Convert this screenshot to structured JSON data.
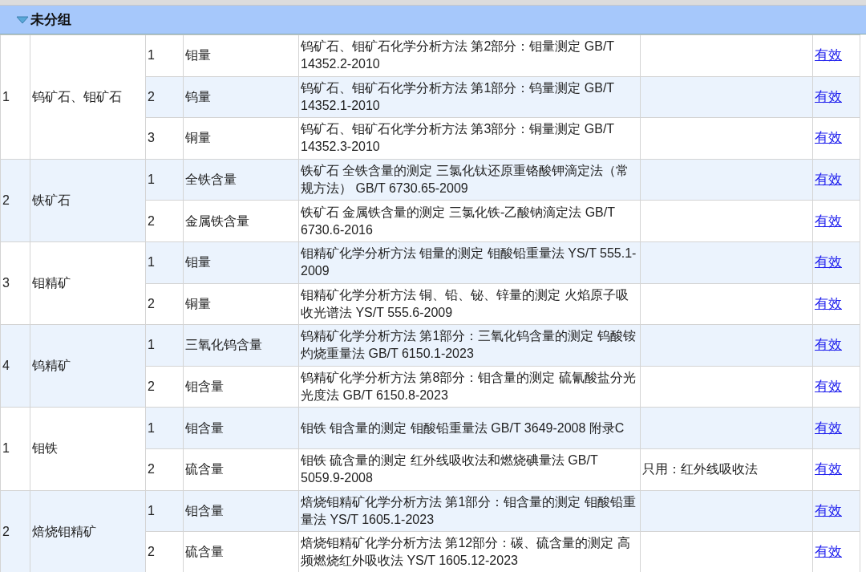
{
  "group": {
    "label": "未分组",
    "expanded": true
  },
  "rows": [
    {
      "no": "1",
      "name": "钨矿石、钼矿石",
      "items": [
        {
          "no": "1",
          "item": "钼量",
          "standard": "钨矿石、钼矿石化学分析方法 第2部分：钼量测定 GB/T 14352.2-2010",
          "status": "有效"
        },
        {
          "no": "2",
          "item": "钨量",
          "standard": "钨矿石、钼矿石化学分析方法 第1部分：钨量测定 GB/T 14352.1-2010",
          "status": "有效"
        },
        {
          "no": "3",
          "item": "铜量",
          "standard": "钨矿石、钼矿石化学分析方法 第3部分：铜量测定 GB/T 14352.3-2010",
          "status": "有效"
        }
      ]
    },
    {
      "no": "2",
      "name": "铁矿石",
      "items": [
        {
          "no": "1",
          "item": "全铁含量",
          "standard": "铁矿石 全铁含量的测定 三氯化钛还原重铬酸钾滴定法（常规方法） GB/T 6730.65-2009",
          "status": "有效"
        },
        {
          "no": "2",
          "item": "金属铁含量",
          "standard": "铁矿石 金属铁含量的测定 三氯化铁-乙酸钠滴定法 GB/T 6730.6-2016",
          "status": "有效"
        }
      ]
    },
    {
      "no": "3",
      "name": "钼精矿",
      "items": [
        {
          "no": "1",
          "item": "钼量",
          "standard": "钼精矿化学分析方法 钼量的测定 钼酸铅重量法 YS/T 555.1-2009",
          "status": "有效"
        },
        {
          "no": "2",
          "item": "铜量",
          "standard": "钼精矿化学分析方法 铜、铅、铋、锌量的测定 火焰原子吸收光谱法 YS/T 555.6-2009",
          "status": "有效"
        }
      ]
    },
    {
      "no": "4",
      "name": "钨精矿",
      "items": [
        {
          "no": "1",
          "item": "三氧化钨含量",
          "standard": "钨精矿化学分析方法 第1部分：三氧化钨含量的测定 钨酸铵灼烧重量法 GB/T 6150.1-2023",
          "status": "有效"
        },
        {
          "no": "2",
          "item": "钼含量",
          "standard": "钨精矿化学分析方法 第8部分：钼含量的测定 硫氰酸盐分光光度法 GB/T 6150.8-2023",
          "status": "有效"
        }
      ]
    },
    {
      "no": "1",
      "name": "钼铁",
      "items": [
        {
          "no": "1",
          "item": "钼含量",
          "standard": "钼铁 钼含量的测定 钼酸铅重量法 GB/T 3649-2008 附录C",
          "status": "有效"
        },
        {
          "no": "2",
          "item": "硫含量",
          "standard": "钼铁 硫含量的测定 红外线吸收法和燃烧碘量法 GB/T 5059.9-2008",
          "note": "只用：红外线吸收法",
          "status": "有效"
        }
      ]
    },
    {
      "no": "2",
      "name": "焙烧钼精矿",
      "items": [
        {
          "no": "1",
          "item": "钼含量",
          "standard": "焙烧钼精矿化学分析方法 第1部分：钼含量的测定 钼酸铅重量法 YS/T 1605.1-2023",
          "status": "有效"
        },
        {
          "no": "2",
          "item": "硫含量",
          "standard": "焙烧钼精矿化学分析方法 第12部分：碳、硫含量的测定 高频燃烧红外吸收法 YS/T 1605.12-2023",
          "status": "有效"
        }
      ]
    }
  ]
}
